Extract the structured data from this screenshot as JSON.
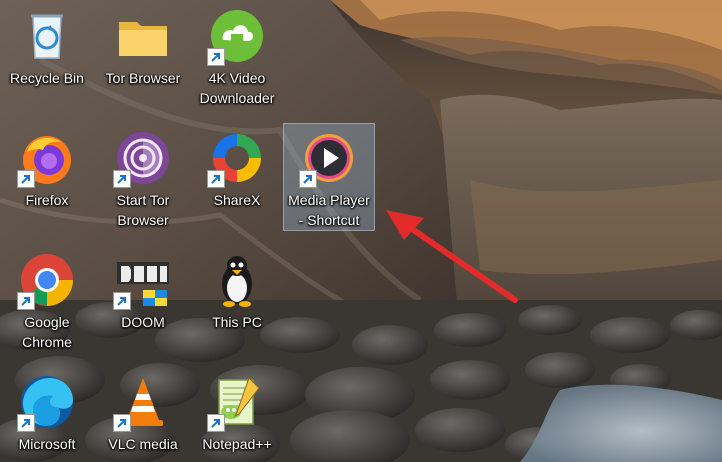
{
  "desktop": {
    "icons": [
      {
        "label": "Recycle Bin",
        "icon": "recycle-bin-icon",
        "shortcut": false
      },
      {
        "label": "Tor Browser",
        "icon": "folder-icon",
        "shortcut": false
      },
      {
        "label": "4K Video\nDownloader",
        "icon": "4k-video-downloader-icon",
        "shortcut": true
      },
      {
        "label": "Firefox",
        "icon": "firefox-icon",
        "shortcut": true
      },
      {
        "label": "Start Tor\nBrowser",
        "icon": "tor-browser-icon",
        "shortcut": true
      },
      {
        "label": "ShareX",
        "icon": "sharex-icon",
        "shortcut": true
      },
      {
        "label": "Media Player\n- Shortcut",
        "icon": "media-player-icon",
        "shortcut": true,
        "selected": true
      },
      {
        "label": "Google\nChrome",
        "icon": "chrome-icon",
        "shortcut": true
      },
      {
        "label": "DOOM",
        "icon": "doom-icon",
        "shortcut": true
      },
      {
        "label": "This PC",
        "icon": "tux-penguin-icon",
        "shortcut": false
      },
      {
        "label": "Microsoft",
        "icon": "edge-icon",
        "shortcut": true
      },
      {
        "label": "VLC media",
        "icon": "vlc-icon",
        "shortcut": true
      },
      {
        "label": "Notepad++",
        "icon": "notepad-plus-plus-icon",
        "shortcut": true
      }
    ]
  },
  "annotation": {
    "arrow_color": "#e32b2b",
    "points_to": "Media Player - Shortcut"
  },
  "colors": {
    "selection": "#add8ff",
    "label_text": "#ffffff"
  }
}
